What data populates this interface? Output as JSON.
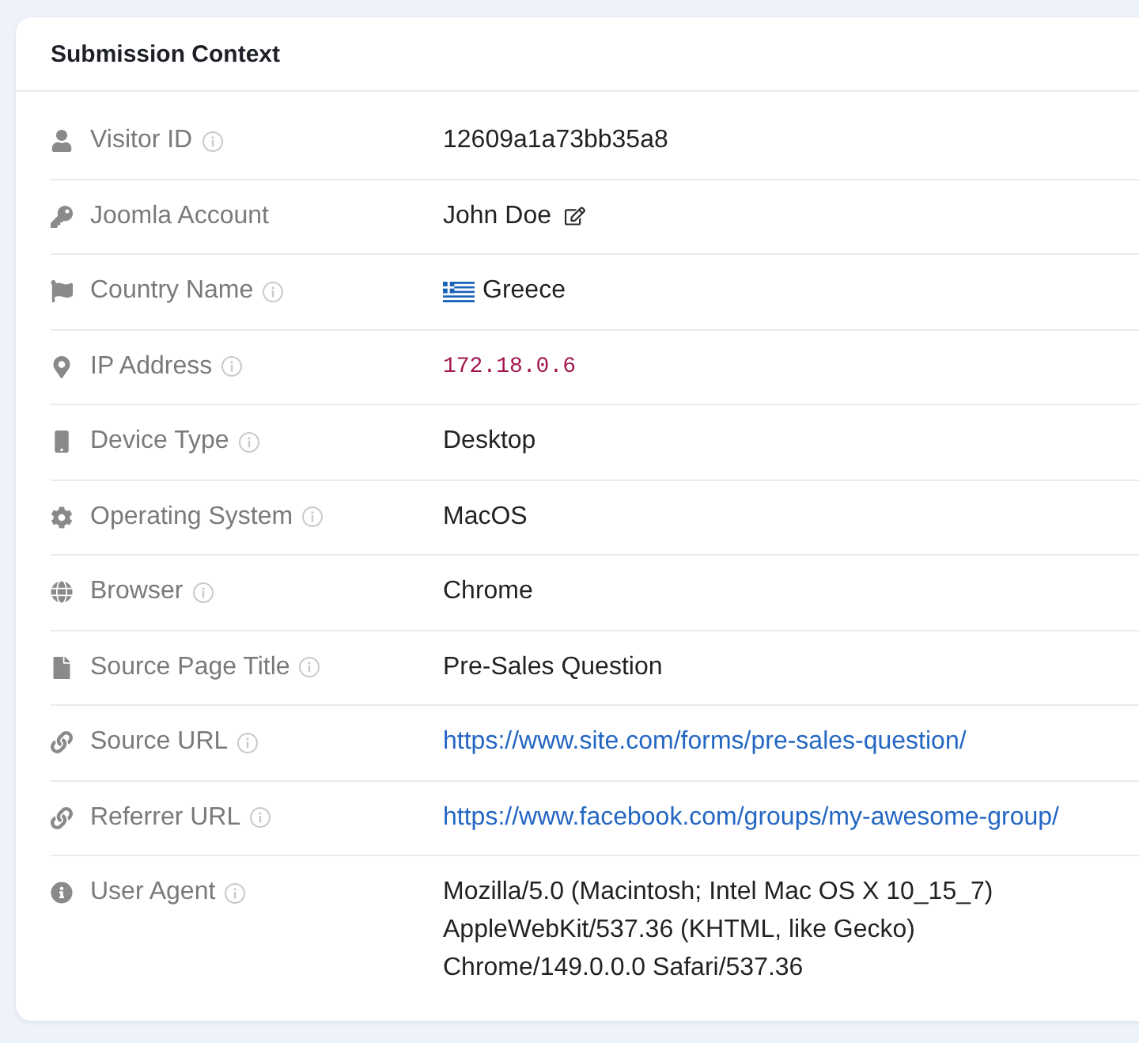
{
  "card": {
    "title": "Submission Context"
  },
  "rows": [
    {
      "label": "Visitor ID",
      "info": true,
      "kind": "text",
      "value": "12609a1a73bb35a8"
    },
    {
      "label": "Joomla Account",
      "info": false,
      "kind": "account",
      "value": "John Doe"
    },
    {
      "label": "Country Name",
      "info": true,
      "kind": "country",
      "value": "Greece"
    },
    {
      "label": "IP Address",
      "info": true,
      "kind": "code",
      "value": "172.18.0.6"
    },
    {
      "label": "Device Type",
      "info": true,
      "kind": "text",
      "value": "Desktop"
    },
    {
      "label": "Operating System",
      "info": true,
      "kind": "text",
      "value": "MacOS"
    },
    {
      "label": "Browser",
      "info": true,
      "kind": "text",
      "value": "Chrome"
    },
    {
      "label": "Source Page Title",
      "info": true,
      "kind": "text",
      "value": "Pre-Sales Question"
    },
    {
      "label": "Source URL",
      "info": true,
      "kind": "link",
      "value": "https://www.site.com/forms/pre-sales-question/"
    },
    {
      "label": "Referrer URL",
      "info": true,
      "kind": "link",
      "value": "https://www.facebook.com/groups/my-awesome-group/"
    },
    {
      "label": "User Agent",
      "info": true,
      "kind": "text",
      "value": "Mozilla/5.0 (Macintosh; Intel Mac OS X 10_15_7) AppleWebKit/537.36 (KHTML, like Gecko) Chrome/149.0.0.0 Safari/537.36"
    }
  ]
}
